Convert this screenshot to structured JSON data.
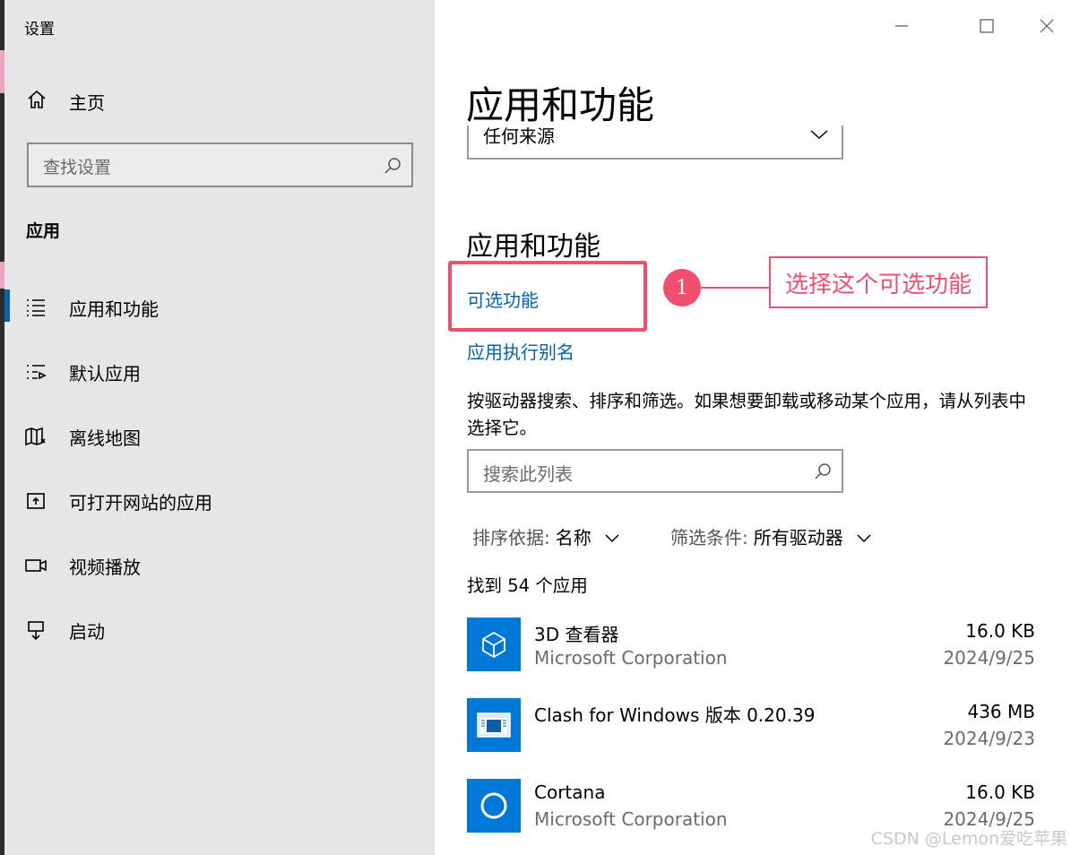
{
  "window": {
    "title": "设置"
  },
  "sidebar": {
    "home_label": "主页",
    "search_placeholder": "查找设置",
    "section_title": "应用",
    "items": [
      {
        "label": "应用和功能",
        "icon": "apps-features-icon",
        "active": true
      },
      {
        "label": "默认应用",
        "icon": "default-apps-icon"
      },
      {
        "label": "离线地图",
        "icon": "offline-maps-icon"
      },
      {
        "label": "可打开网站的应用",
        "icon": "apps-for-websites-icon"
      },
      {
        "label": "视频播放",
        "icon": "video-playback-icon"
      },
      {
        "label": "启动",
        "icon": "startup-icon"
      }
    ]
  },
  "main": {
    "page_title": "应用和功能",
    "source_select_value": "任何来源",
    "section_title": "应用和功能",
    "links": {
      "optional_features": "可选功能",
      "app_execution_alias": "应用执行别名"
    },
    "description": "按驱动器搜索、排序和筛选。如果想要卸载或移动某个应用，请从列表中选择它。",
    "list_search_placeholder": "搜索此列表",
    "sort": {
      "label": "排序依据:",
      "value": "名称"
    },
    "filter": {
      "label": "筛选条件:",
      "value": "所有驱动器"
    },
    "count_text": "找到 54 个应用",
    "apps": [
      {
        "name": "3D 查看器",
        "publisher": "Microsoft Corporation",
        "size": "16.0 KB",
        "date": "2024/9/25"
      },
      {
        "name": "Clash for Windows 版本 0.20.39",
        "publisher": "",
        "size": "436 MB",
        "date": "2024/9/23"
      },
      {
        "name": "Cortana",
        "publisher": "Microsoft Corporation",
        "size": "16.0 KB",
        "date": "2024/9/25"
      }
    ]
  },
  "annotation": {
    "number": "1",
    "text": "选择这个可选功能",
    "color": "#f0506e"
  },
  "colors": {
    "accent": "#0063b1",
    "tile": "#0078d7",
    "sidebar_bg": "#e6e6e6"
  },
  "watermark": "CSDN @Lemon爱吃苹果"
}
